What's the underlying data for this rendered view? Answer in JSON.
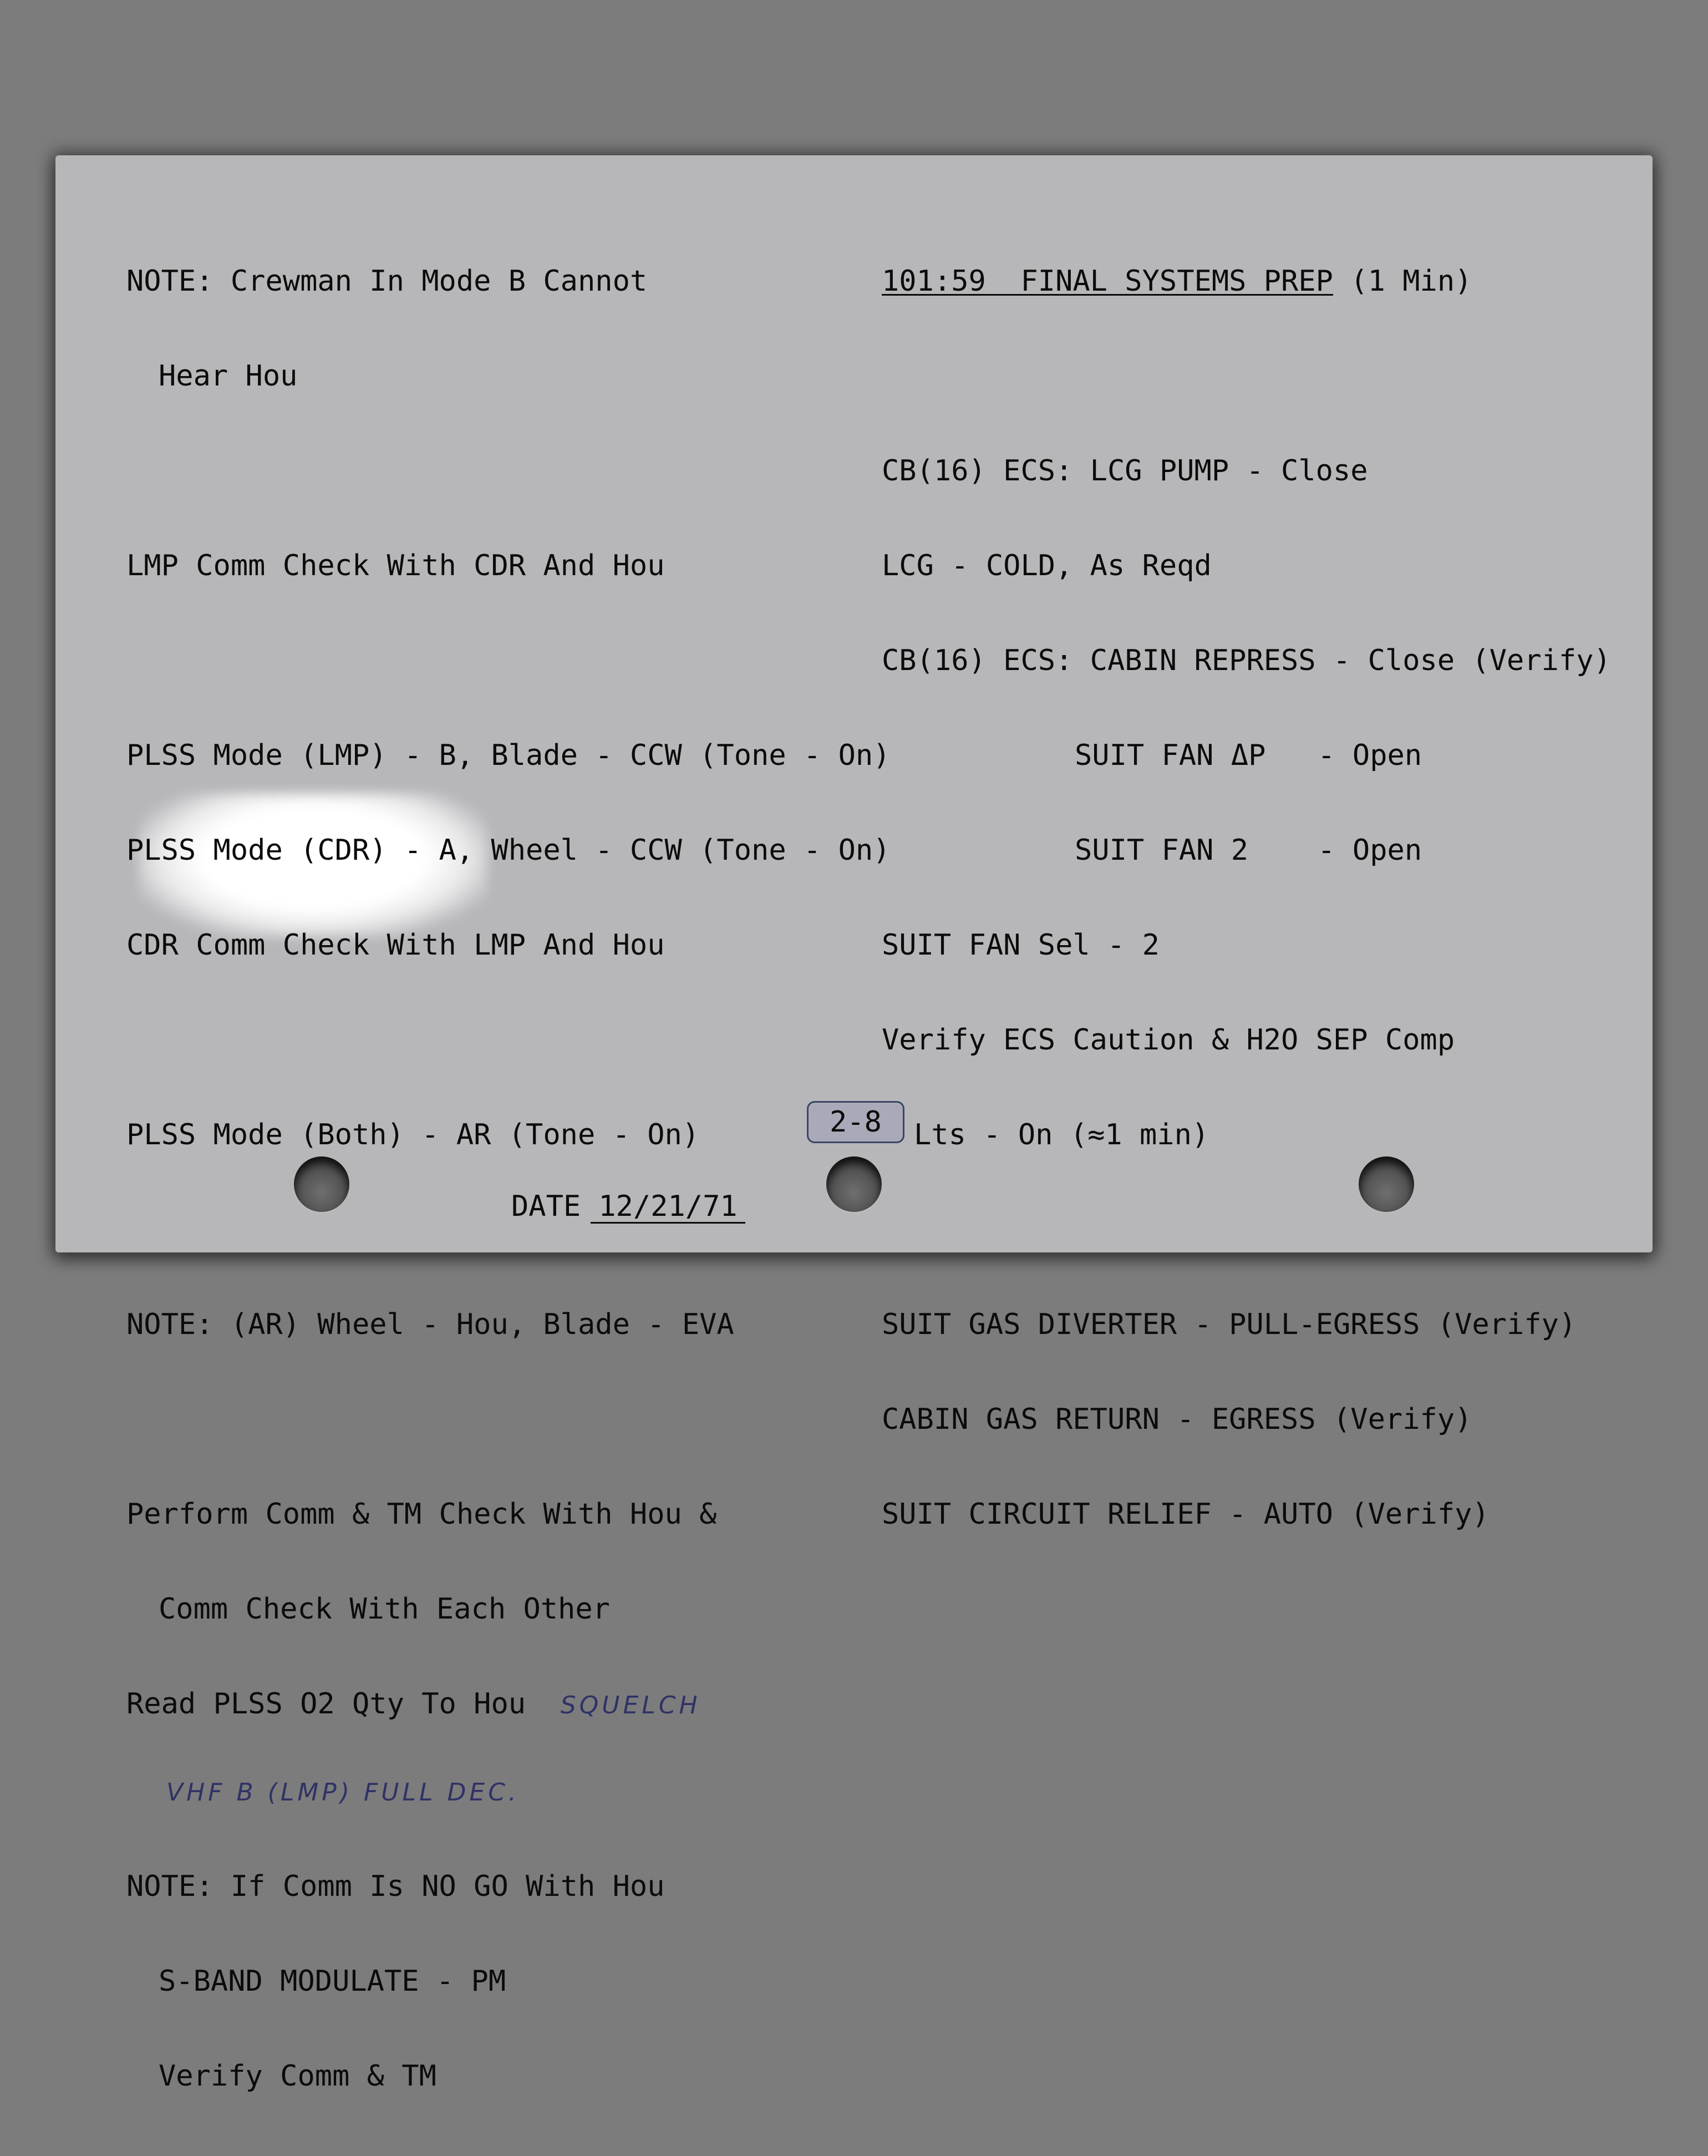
{
  "left_column": {
    "note1_line1": "NOTE: Crewman In Mode B Cannot",
    "note1_line2": "Hear Hou",
    "lmp_comm": "LMP Comm Check With CDR And Hou",
    "plss_lmp": "PLSS Mode (LMP) - B, Blade - CCW (Tone - On)",
    "plss_cdr": "PLSS Mode (CDR) - A, Wheel - CCW (Tone - On)",
    "cdr_comm": "CDR Comm Check With LMP And Hou",
    "plss_both": "PLSS Mode (Both) - AR (Tone - On)",
    "note2": "NOTE: (AR) Wheel - Hou, Blade - EVA",
    "perform_line1": "Perform Comm & TM Check With Hou &",
    "perform_line2": "Comm Check With Each Other",
    "read_plss": "Read PLSS O2 Qty To Hou",
    "hand_squelch": "SQUELCH",
    "hand_vhf": "VHF B (LMP) FULL DEC.",
    "note3_line1": "NOTE: If Comm Is NO GO With Hou",
    "note3_line2": "S-BAND MODULATE - PM",
    "note3_line3": "Verify Comm & TM"
  },
  "right_column": {
    "heading_time": "101:59  FINAL SYSTEMS PREP",
    "heading_duration": " (1 Min)",
    "cb16_lcg": "CB(16) ECS: LCG PUMP - Close",
    "lcg": "LCG - COLD, As Reqd",
    "cb16_cabin": "CB(16) ECS: CABIN REPRESS - Close (Verify)",
    "suit_fan_dp": "SUIT FAN ΔP   - Open",
    "suit_fan_2": "SUIT FAN 2    - Open",
    "suit_fan_sel": "SUIT FAN Sel - 2",
    "verify_ecs_line1": "Verify ECS Caution & H2O SEP Comp",
    "verify_ecs_line2": "Lts - On (≈1 min)",
    "suit_gas": "SUIT GAS DIVERTER - PULL-EGRESS (Verify)",
    "cabin_gas": "CABIN GAS RETURN - EGRESS (Verify)",
    "suit_circuit": "SUIT CIRCUIT RELIEF - AUTO (Verify)"
  },
  "footer": {
    "page_number": "2-8",
    "date_label": "DATE",
    "date_value": "12/21/71"
  }
}
